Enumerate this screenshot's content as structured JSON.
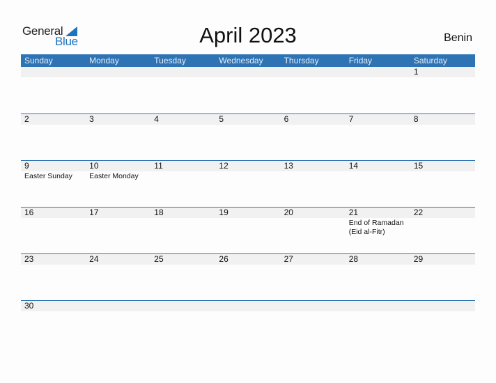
{
  "logo": {
    "line1": "General",
    "line2": "Blue"
  },
  "header": {
    "title": "April 2023",
    "country": "Benin"
  },
  "colors": {
    "accent": "#2e74b5",
    "band": "#f1f1f1",
    "logo_blue": "#1e73be"
  },
  "weekdays": [
    "Sunday",
    "Monday",
    "Tuesday",
    "Wednesday",
    "Thursday",
    "Friday",
    "Saturday"
  ],
  "weeks": [
    [
      {
        "d": ""
      },
      {
        "d": ""
      },
      {
        "d": ""
      },
      {
        "d": ""
      },
      {
        "d": ""
      },
      {
        "d": ""
      },
      {
        "d": "1"
      }
    ],
    [
      {
        "d": "2"
      },
      {
        "d": "3"
      },
      {
        "d": "4"
      },
      {
        "d": "5"
      },
      {
        "d": "6"
      },
      {
        "d": "7"
      },
      {
        "d": "8"
      }
    ],
    [
      {
        "d": "9",
        "e": "Easter Sunday"
      },
      {
        "d": "10",
        "e": "Easter Monday"
      },
      {
        "d": "11"
      },
      {
        "d": "12"
      },
      {
        "d": "13"
      },
      {
        "d": "14"
      },
      {
        "d": "15"
      }
    ],
    [
      {
        "d": "16"
      },
      {
        "d": "17"
      },
      {
        "d": "18"
      },
      {
        "d": "19"
      },
      {
        "d": "20"
      },
      {
        "d": "21",
        "e": "End of Ramadan (Eid al-Fitr)"
      },
      {
        "d": "22"
      }
    ],
    [
      {
        "d": "23"
      },
      {
        "d": "24"
      },
      {
        "d": "25"
      },
      {
        "d": "26"
      },
      {
        "d": "27"
      },
      {
        "d": "28"
      },
      {
        "d": "29"
      }
    ],
    [
      {
        "d": "30"
      },
      {
        "d": ""
      },
      {
        "d": ""
      },
      {
        "d": ""
      },
      {
        "d": ""
      },
      {
        "d": ""
      },
      {
        "d": ""
      }
    ]
  ]
}
